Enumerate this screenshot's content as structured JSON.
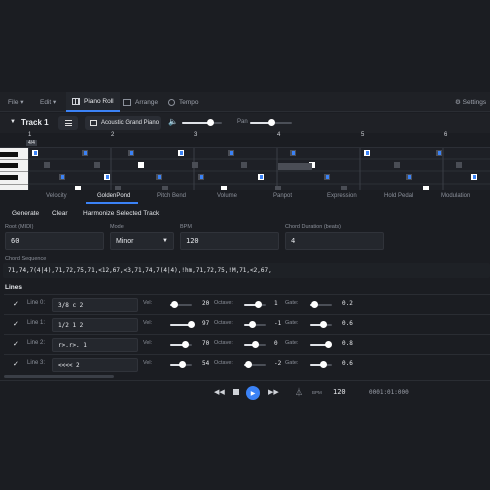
{
  "menu": {
    "file": "File",
    "edit": "Edit",
    "settings": "Settings"
  },
  "tabs": [
    {
      "label": "Piano Roll"
    },
    {
      "label": "Arrange"
    },
    {
      "label": "Tempo"
    }
  ],
  "track": {
    "name": "Track 1",
    "instrument": "Acoustic Grand Piano",
    "pan_label": "Pan",
    "volume": 0.7,
    "pan": 0.5
  },
  "ruler": {
    "marks": [
      "1",
      "2",
      "3",
      "4",
      "5",
      "6"
    ],
    "time_sig": "4/4"
  },
  "lanes": [
    "Velocity",
    "GoldenPond",
    "Pitch Bend",
    "Volume",
    "Panpot",
    "Expression",
    "Hold Pedal",
    "Modulation"
  ],
  "actions": {
    "generate": "Generate",
    "clear": "Clear",
    "harmonize": "Harmonize Selected Track"
  },
  "fields": {
    "root_label": "Root (MIDI)",
    "root_value": "60",
    "mode_label": "Mode",
    "mode_value": "Minor",
    "bpm_label": "BPM",
    "bpm_value": "120",
    "chord_duration_label": "Chord Duration (beats)",
    "chord_duration_value": "4",
    "chord_sequence_label": "Chord Sequence",
    "chord_sequence_value": "71,74,7(4|4),71,72,75,71,<12,67,<3,71,74,7(4|4),!hm,71,72,75,!M,71,<2,67,"
  },
  "lines_title": "Lines",
  "line_labels": {
    "vel": "Vel:",
    "octave": "Octave:",
    "gate": "Gate:"
  },
  "lines": [
    {
      "name": "Line 0:",
      "pattern": "3/8 c 2",
      "vel": "20",
      "octave": "1",
      "gate": "0.2",
      "vel_level": 0.2,
      "oct_level": 0.65,
      "gate_level": 0.2
    },
    {
      "name": "Line 1:",
      "pattern": "1/2 1 2",
      "vel": "97",
      "octave": "-1",
      "gate": "0.6",
      "vel_level": 0.97,
      "oct_level": 0.35,
      "gate_level": 0.6
    },
    {
      "name": "Line 2:",
      "pattern": "r>.r>. 1",
      "vel": "70",
      "octave": "0",
      "gate": "0.8",
      "vel_level": 0.7,
      "oct_level": 0.5,
      "gate_level": 0.8
    },
    {
      "name": "Line 3:",
      "pattern": "<<<< 2",
      "vel": "54",
      "octave": "-2",
      "gate": "0.6",
      "vel_level": 0.54,
      "oct_level": 0.2,
      "gate_level": 0.6
    }
  ],
  "transport": {
    "bpm_label": "BPM",
    "bpm": "120",
    "time": "0001:01:000"
  },
  "colors": {
    "accent": "#3b82f6",
    "background": "#1b1d22"
  }
}
